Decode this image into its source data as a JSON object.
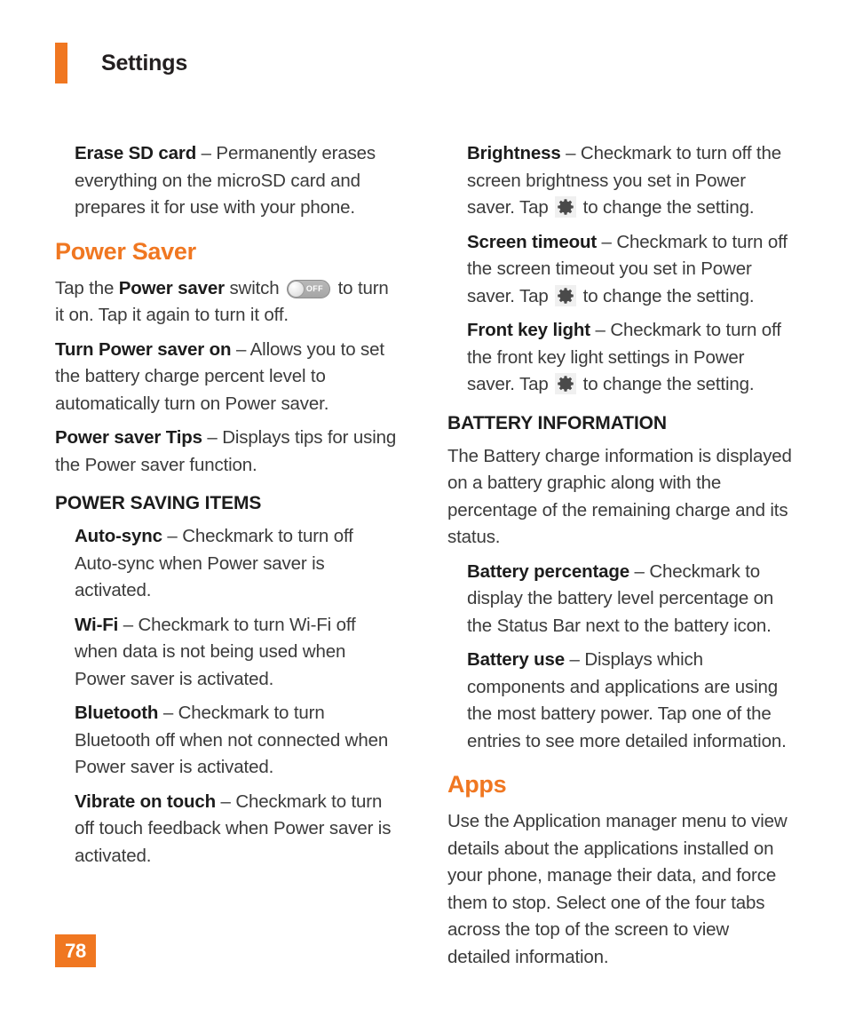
{
  "header": {
    "title": "Settings",
    "accent_color": "#F07721"
  },
  "left_column": {
    "erase_sd": {
      "term": "Erase SD card",
      "dash": " – ",
      "text": "Permanently erases everything on the microSD card and prepares it for use with your phone."
    },
    "power_saver_heading": "Power Saver",
    "power_saver_intro_1": "Tap the ",
    "power_saver_intro_bold": "Power saver",
    "power_saver_intro_2": " switch ",
    "toggle_label": "OFF",
    "power_saver_intro_3": " to turn it on. Tap it again to turn it off.",
    "turn_power_saver_on": {
      "term": "Turn Power saver on",
      "dash": " – ",
      "text": "Allows you to set the battery charge percent level to automatically turn on Power saver."
    },
    "power_saver_tips": {
      "term": "Power saver Tips",
      "dash": " – ",
      "text": "Displays tips for using the Power saver function."
    },
    "power_saving_items_heading": "POWER SAVING ITEMS",
    "auto_sync": {
      "term": "Auto-sync",
      "dash": " – ",
      "text": "Checkmark to turn off Auto-sync when Power saver is activated."
    },
    "wifi": {
      "term": "Wi-Fi",
      "dash": " – ",
      "text": "Checkmark to turn Wi-Fi off when data is not being used when Power saver is activated."
    },
    "bluetooth": {
      "term": "Bluetooth",
      "dash": " – ",
      "text": "Checkmark to turn Bluetooth off when not connected when Power saver is activated."
    },
    "vibrate_on_touch": {
      "term": "Vibrate on touch",
      "dash": " – ",
      "text": "Checkmark to turn off touch feedback when Power saver is activated."
    }
  },
  "right_column": {
    "brightness": {
      "term": "Brightness",
      "dash": " – ",
      "text_before_icon": "Checkmark to turn off the screen brightness you set in Power saver. Tap ",
      "text_after_icon": " to change the setting."
    },
    "screen_timeout": {
      "term": "Screen timeout",
      "dash": " – ",
      "text_before_icon": "Checkmark to turn off the screen timeout you set in Power saver. Tap ",
      "text_after_icon": " to change the setting."
    },
    "front_key_light": {
      "term": "Front key light",
      "dash": " – ",
      "text_before_icon": "Checkmark to turn off the front key light settings in Power saver. Tap ",
      "text_after_icon": " to change the setting."
    },
    "battery_information_heading": "BATTERY INFORMATION",
    "battery_information_intro": "The Battery charge information is displayed on a battery graphic along with the percentage of the remaining charge and its status.",
    "battery_percentage": {
      "term": "Battery percentage",
      "dash": " – ",
      "text": "Checkmark to display the battery level percentage on the Status Bar next to the battery icon."
    },
    "battery_use": {
      "term": "Battery use",
      "dash": " – ",
      "text": "Displays which components and applications are using the most battery power. Tap one of the entries to see more detailed information."
    },
    "apps_heading": "Apps",
    "apps_text": "Use the Application manager menu to view details about the applications installed on your phone, manage their data, and force them to stop. Select one of the four tabs across the top of the screen to view detailed information."
  },
  "footer": {
    "page_number": "78"
  },
  "icons": {
    "gear": "gear-icon",
    "toggle": "toggle-switch-off"
  }
}
